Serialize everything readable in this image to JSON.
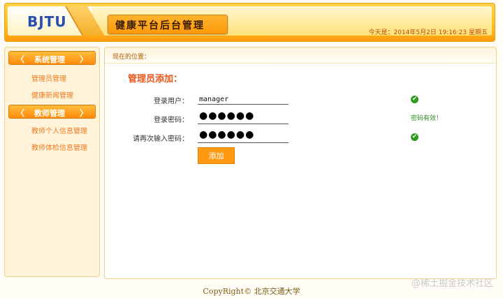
{
  "header": {
    "logo": "BJTU",
    "title": "健康平台后台管理",
    "date": "今天是：2014年5月2日 19:16:23 星期五"
  },
  "sidebar": {
    "chev_left": "〈",
    "chev_right": "〉",
    "sections": [
      {
        "title": "系统管理",
        "items": [
          "管理员管理",
          "健康新闻管理"
        ]
      },
      {
        "title": "教师管理",
        "items": [
          "教师个人信息管理",
          "教师体检信息管理"
        ]
      }
    ]
  },
  "main": {
    "location": "现在的位置：",
    "form_title": "管理员添加：",
    "fields": [
      {
        "label": "登录用户：",
        "value": "manager"
      },
      {
        "label": "登录密码：",
        "value": "●●●●●●"
      },
      {
        "label": "请再次输入密码：",
        "value": "●●●●●●"
      }
    ],
    "password_valid_text": "密码有效！",
    "check_mark": "✔",
    "add_button": "添加"
  },
  "footer": {
    "copyright": "CopyRight©",
    "org": "北京交通大学",
    "watermark": "@稀土掘金技术社区"
  },
  "colors": {
    "accent": "#ff9a12",
    "link": "#ee7c1e",
    "title": "#e6561c",
    "success": "#2f9b1f"
  }
}
